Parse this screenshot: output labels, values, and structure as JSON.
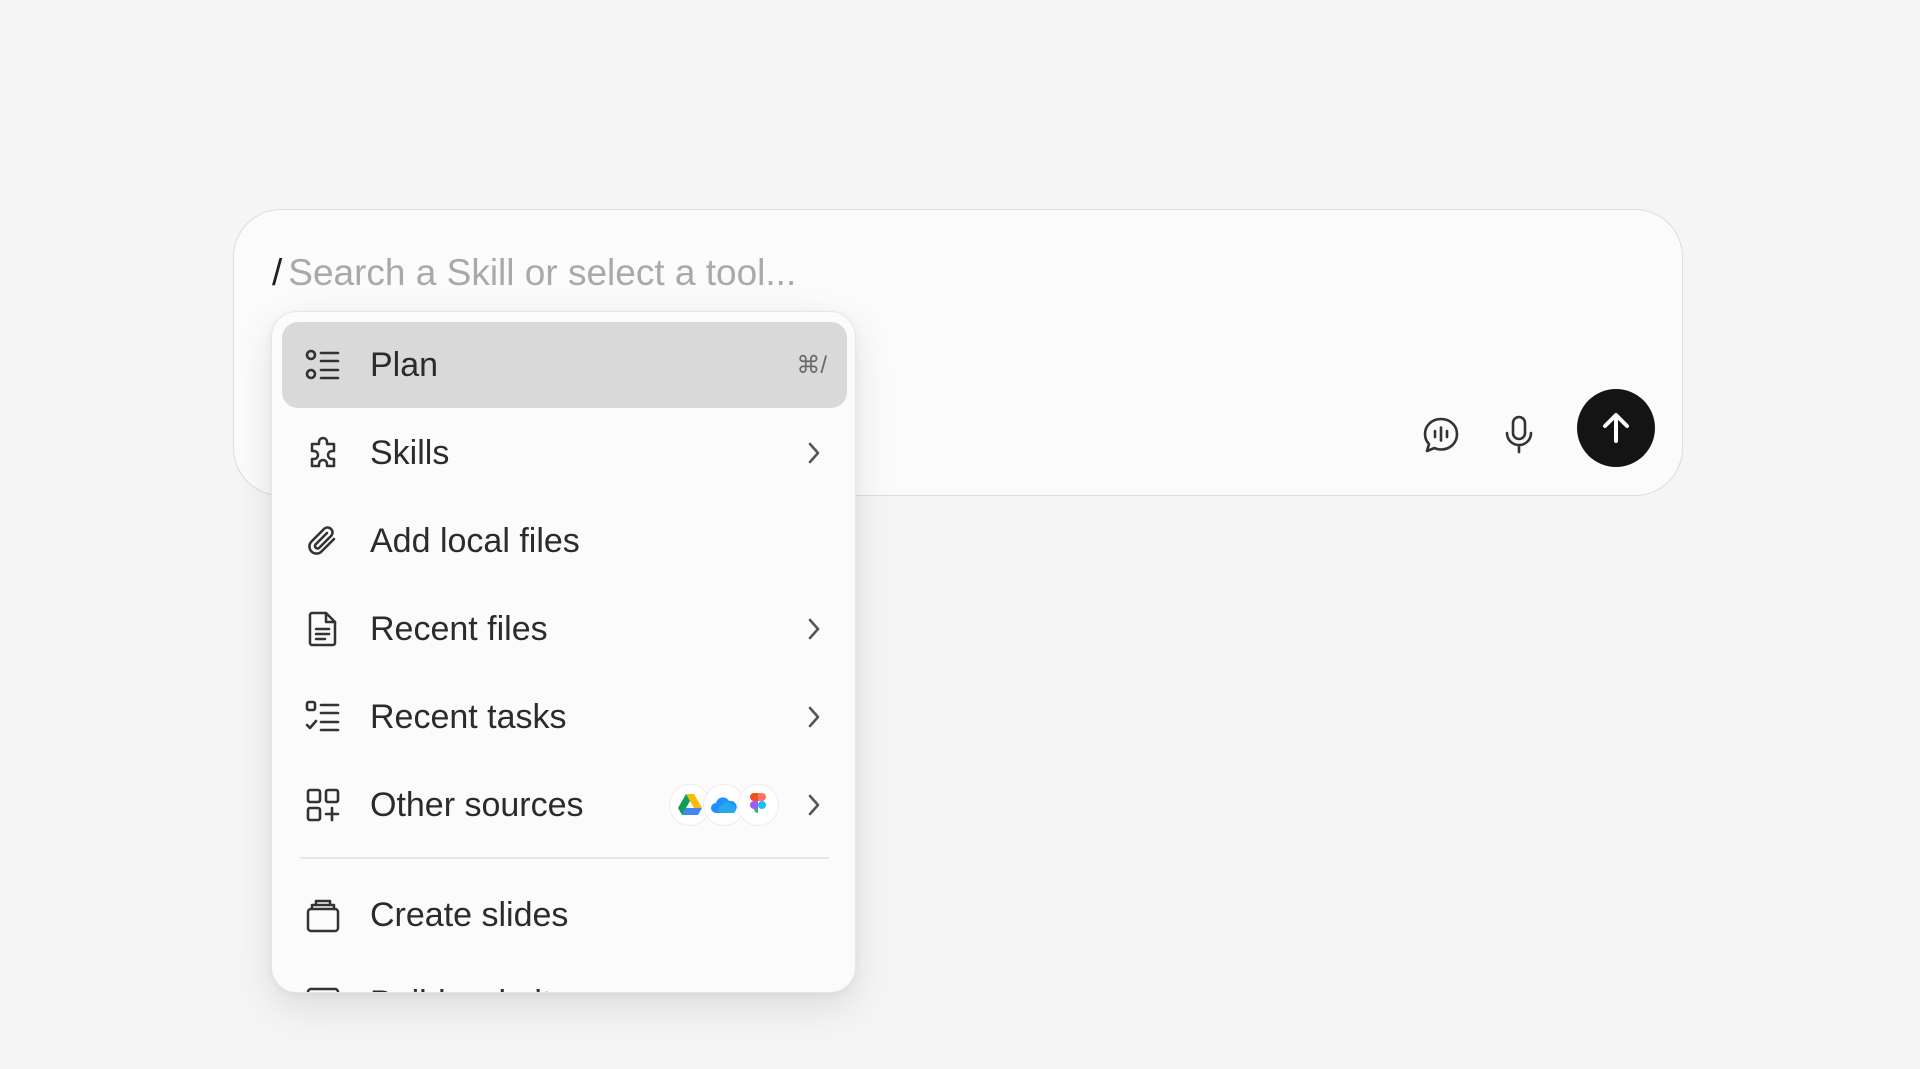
{
  "composer": {
    "slash": "/",
    "placeholder": "Search a Skill or select a tool...",
    "voice_icon": "voice-chat-icon",
    "mic_icon": "microphone-icon",
    "send_icon": "arrow-up-icon"
  },
  "menu": {
    "items": [
      {
        "label": "Plan",
        "icon": "list-icon",
        "shortcut": "⌘/",
        "active": true
      },
      {
        "label": "Skills",
        "icon": "puzzle-icon",
        "submenu": true
      },
      {
        "label": "Add local files",
        "icon": "paperclip-icon"
      },
      {
        "label": "Recent files",
        "icon": "document-icon",
        "submenu": true
      },
      {
        "label": "Recent tasks",
        "icon": "checklist-icon",
        "submenu": true
      },
      {
        "label": "Other sources",
        "icon": "apps-add-icon",
        "submenu": true,
        "sources": [
          "google-drive-logo",
          "onedrive-logo",
          "figma-logo"
        ]
      },
      {
        "label": "Create slides",
        "icon": "slides-icon"
      },
      {
        "label": "Build website",
        "icon": "website-icon"
      }
    ]
  },
  "colors": {
    "background": "#f5f5f5",
    "active_row": "#d9d9d9",
    "send_button": "#141414"
  }
}
